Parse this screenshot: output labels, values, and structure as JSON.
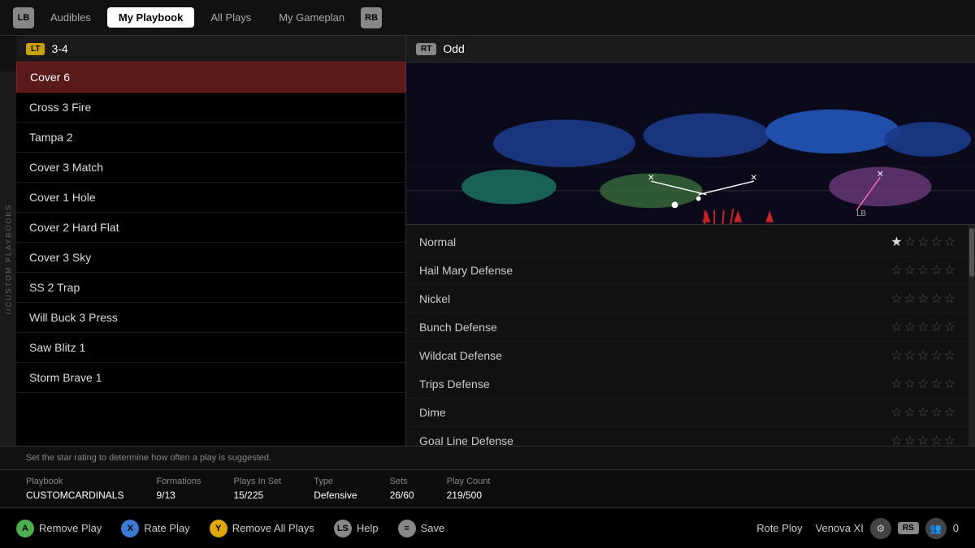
{
  "nav": {
    "lb_label": "LB",
    "rb_label": "RB",
    "tabs": [
      {
        "label": "Audibles",
        "active": false
      },
      {
        "label": "My Playbook",
        "active": true
      },
      {
        "label": "All Plays",
        "active": false
      },
      {
        "label": "My Gameplan",
        "active": false
      }
    ]
  },
  "sidebar_label": "//CUSTOM PLAYBOOKS",
  "left_panel": {
    "lt_badge": "LT",
    "formation": "3-4",
    "plays": [
      {
        "name": "Cover 6",
        "selected": true
      },
      {
        "name": "Cross 3 Fire",
        "selected": false
      },
      {
        "name": "Tampa 2",
        "selected": false
      },
      {
        "name": "Cover 3 Match",
        "selected": false
      },
      {
        "name": "Cover 1 Hole",
        "selected": false
      },
      {
        "name": "Cover 2 Hard Flat",
        "selected": false
      },
      {
        "name": "Cover 3 Sky",
        "selected": false
      },
      {
        "name": "SS 2 Trap",
        "selected": false
      },
      {
        "name": "Will Buck 3 Press",
        "selected": false
      },
      {
        "name": "Saw Blitz 1",
        "selected": false
      },
      {
        "name": "Storm Brave 1",
        "selected": false
      }
    ]
  },
  "right_panel": {
    "rt_badge": "RT",
    "formation": "Odd",
    "ratings": [
      {
        "label": "Normal",
        "stars": 1
      },
      {
        "label": "Hail Mary Defense",
        "stars": 0
      },
      {
        "label": "Nickel",
        "stars": 0
      },
      {
        "label": "Bunch Defense",
        "stars": 0
      },
      {
        "label": "Wildcat Defense",
        "stars": 0
      },
      {
        "label": "Trips Defense",
        "stars": 0
      },
      {
        "label": "Dime",
        "stars": 0
      },
      {
        "label": "Goal Line Defense",
        "stars": 0
      }
    ]
  },
  "info_bar": {
    "text": "Set the star rating to determine how often a play is suggested."
  },
  "stats": {
    "playbook_label": "Playbook",
    "playbook_value": "CUSTOMCARDINALS",
    "formations_label": "Formations",
    "formations_value": "9/13",
    "plays_in_set_label": "Plays In Set",
    "plays_in_set_value": "15/225",
    "type_label": "Type",
    "type_value": "Defensive",
    "sets_label": "Sets",
    "sets_value": "26/60",
    "play_count_label": "Play Count",
    "play_count_value": "219/500"
  },
  "bottom": {
    "actions": [
      {
        "badge": "A",
        "badge_type": "a",
        "label": "Remove Play"
      },
      {
        "badge": "X",
        "badge_type": "x",
        "label": "Rate Play"
      },
      {
        "badge": "Y",
        "badge_type": "y",
        "label": "Remove All Plays"
      },
      {
        "badge": "LS",
        "badge_type": "ls",
        "label": "Help"
      },
      {
        "badge": "≡",
        "badge_type": "eq",
        "label": "Save"
      }
    ],
    "user": {
      "name": "Venova XI",
      "rs_badge": "RS",
      "count": "0"
    },
    "rote_ploy": "Rote Ploy"
  }
}
